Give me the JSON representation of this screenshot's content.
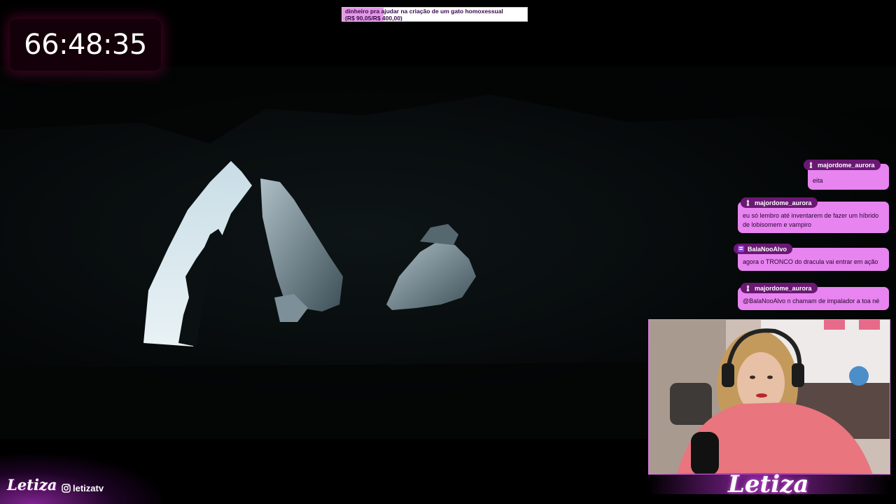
{
  "goal": {
    "line1": "dinheiro pra ajudar na criação de um gato homoxessual",
    "line2": "(R$ 90,05/R$ 400,00)",
    "progress": 0.225,
    "fill_color": "#e59ae8"
  },
  "timer": {
    "value": "66:48:35"
  },
  "chat": {
    "messages": [
      {
        "user": "majordome_aurora",
        "badge": "figure-icon",
        "text": "eita"
      },
      {
        "user": "majordome_aurora",
        "badge": "figure-icon",
        "text": "eu só lembro até inventarem de fazer um híbrido de lobisomem e vampiro"
      },
      {
        "user": "BalaNooAlvo",
        "badge": "list-icon",
        "text": "agora o TRONCO do dracula vai entrar em ação"
      },
      {
        "user": "majordome_aurora",
        "badge": "figure-icon",
        "text": "@BalaNooAlvo n chamam de impalador a toa né"
      }
    ]
  },
  "webcam": {
    "logo": "Letiza"
  },
  "branding": {
    "logo": "Letiza",
    "instagram": "letizatv"
  },
  "colors": {
    "accent": "#e784f0",
    "name_tag": "#6b1874",
    "timer_glow": "#78083c"
  }
}
